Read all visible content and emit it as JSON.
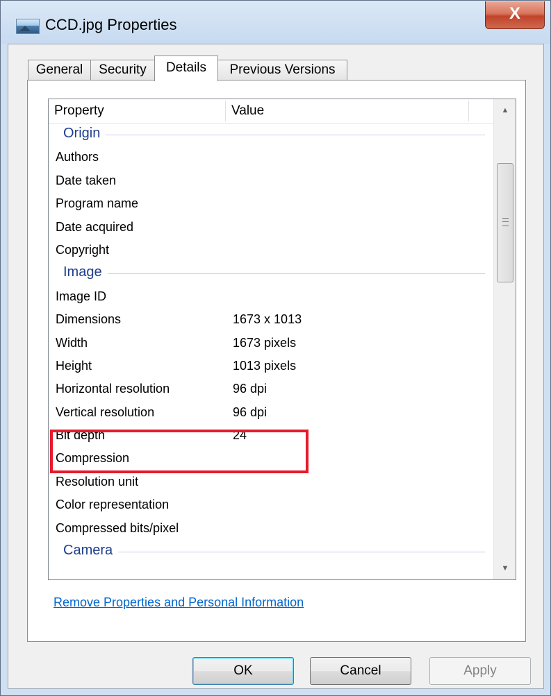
{
  "window": {
    "title": "CCD.jpg Properties",
    "close_label": "X"
  },
  "tabs": [
    {
      "label": "General"
    },
    {
      "label": "Security"
    },
    {
      "label": "Details"
    },
    {
      "label": "Previous Versions"
    }
  ],
  "active_tab": "Details",
  "list": {
    "columns": {
      "property": "Property",
      "value": "Value"
    },
    "sections": [
      {
        "group": "Origin",
        "rows": [
          {
            "name": "Authors",
            "value": ""
          },
          {
            "name": "Date taken",
            "value": ""
          },
          {
            "name": "Program name",
            "value": ""
          },
          {
            "name": "Date acquired",
            "value": ""
          },
          {
            "name": "Copyright",
            "value": ""
          }
        ]
      },
      {
        "group": "Image",
        "rows": [
          {
            "name": "Image ID",
            "value": ""
          },
          {
            "name": "Dimensions",
            "value": "1673 x 1013"
          },
          {
            "name": "Width",
            "value": "1673 pixels"
          },
          {
            "name": "Height",
            "value": "1013 pixels"
          },
          {
            "name": "Horizontal resolution",
            "value": "96 dpi"
          },
          {
            "name": "Vertical resolution",
            "value": "96 dpi"
          },
          {
            "name": "Bit depth",
            "value": "24"
          },
          {
            "name": "Compression",
            "value": ""
          },
          {
            "name": "Resolution unit",
            "value": ""
          },
          {
            "name": "Color representation",
            "value": ""
          },
          {
            "name": "Compressed bits/pixel",
            "value": ""
          }
        ]
      },
      {
        "group": "Camera",
        "rows": []
      }
    ]
  },
  "highlight_color": "#e8192c",
  "remove_link": "Remove Properties and Personal Information",
  "buttons": {
    "ok": "OK",
    "cancel": "Cancel",
    "apply": "Apply"
  }
}
